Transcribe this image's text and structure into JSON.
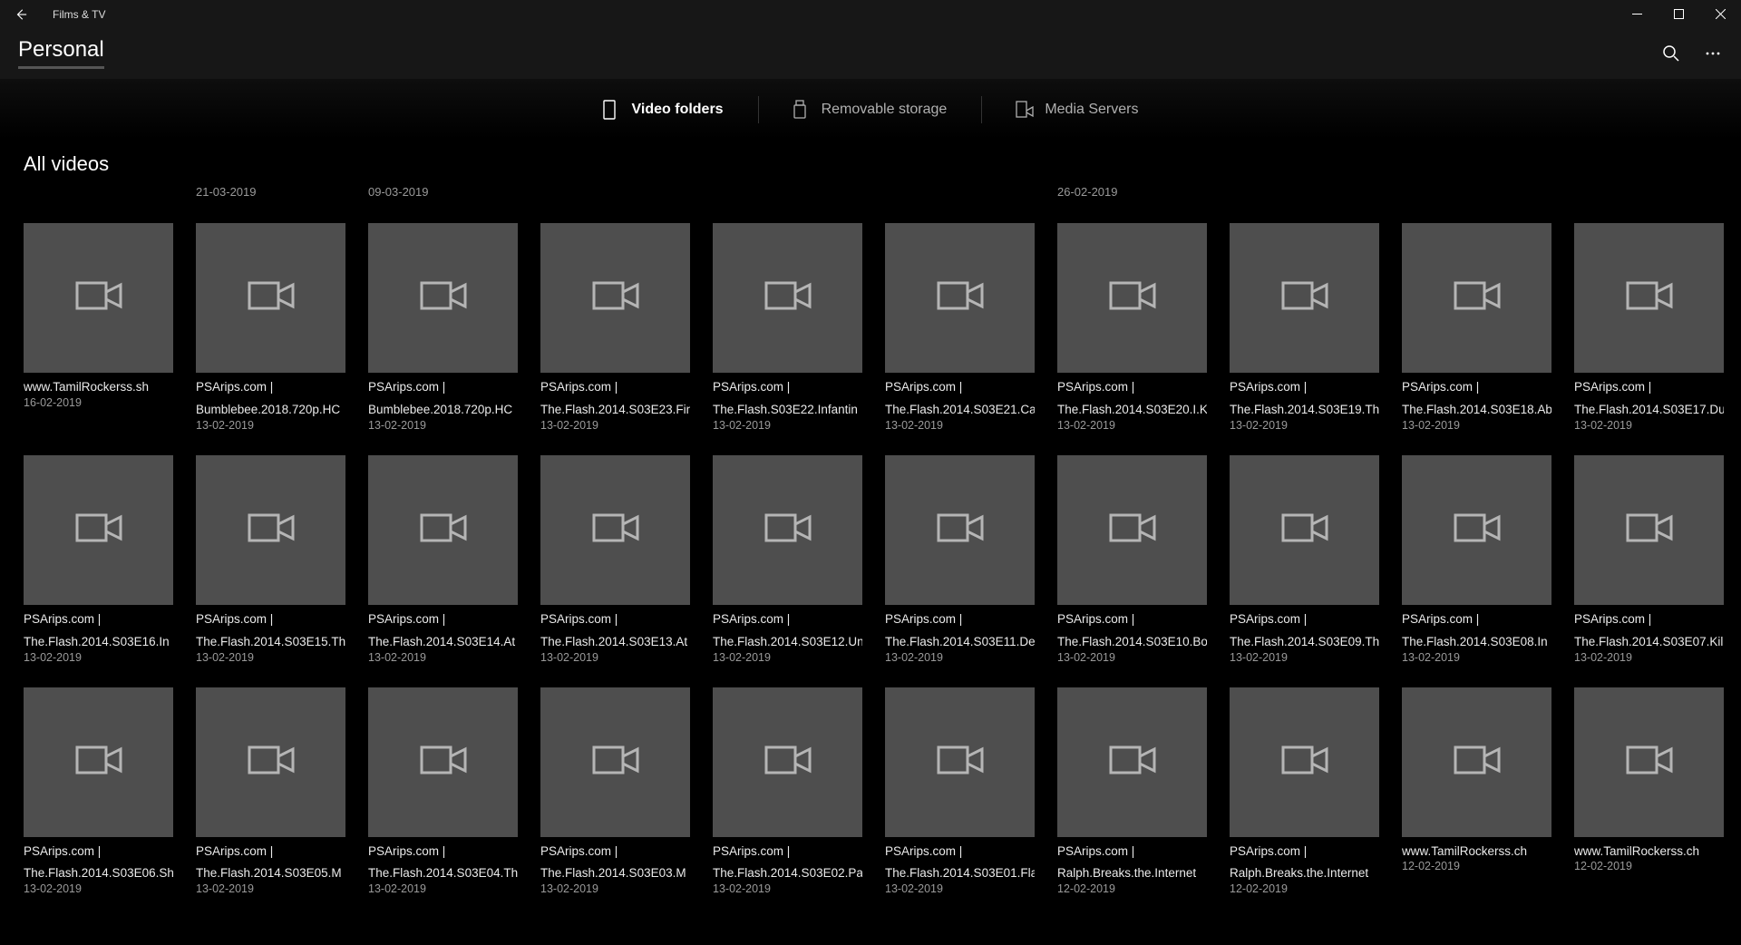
{
  "app_name": "Films & TV",
  "page_title": "Personal",
  "tabs": {
    "video_folders": "Video folders",
    "removable_storage": "Removable storage",
    "media_servers": "Media Servers"
  },
  "section_title": "All videos",
  "date_headers": [
    "",
    "21-03-2019",
    "09-03-2019",
    "",
    "",
    "",
    "26-02-2019",
    "",
    "",
    ""
  ],
  "items": [
    {
      "name": "www.TamilRockerss.sh",
      "name2": "",
      "date": "16-02-2019"
    },
    {
      "name": "PSArips.com |",
      "name2": "Bumblebee.2018.720p.HC",
      "date": "13-02-2019"
    },
    {
      "name": "PSArips.com |",
      "name2": "Bumblebee.2018.720p.HC",
      "date": "13-02-2019"
    },
    {
      "name": "PSArips.com |",
      "name2": "The.Flash.2014.S03E23.Fin",
      "date": "13-02-2019"
    },
    {
      "name": "PSArips.com |",
      "name2": "The.Flash.S03E22.Infantin",
      "date": "13-02-2019"
    },
    {
      "name": "PSArips.com |",
      "name2": "The.Flash.2014.S03E21.Ca",
      "date": "13-02-2019"
    },
    {
      "name": "PSArips.com |",
      "name2": "The.Flash.2014.S03E20.I.K",
      "date": "13-02-2019"
    },
    {
      "name": "PSArips.com |",
      "name2": "The.Flash.2014.S03E19.Th",
      "date": "13-02-2019"
    },
    {
      "name": "PSArips.com |",
      "name2": "The.Flash.2014.S03E18.Ab",
      "date": "13-02-2019"
    },
    {
      "name": "PSArips.com |",
      "name2": "The.Flash.2014.S03E17.Du",
      "date": "13-02-2019"
    },
    {
      "name": "PSArips.com |",
      "name2": "The.Flash.2014.S03E16.In",
      "date": "13-02-2019"
    },
    {
      "name": "PSArips.com |",
      "name2": "The.Flash.2014.S03E15.Th",
      "date": "13-02-2019"
    },
    {
      "name": "PSArips.com |",
      "name2": "The.Flash.2014.S03E14.At",
      "date": "13-02-2019"
    },
    {
      "name": "PSArips.com |",
      "name2": "The.Flash.2014.S03E13.At",
      "date": "13-02-2019"
    },
    {
      "name": "PSArips.com |",
      "name2": "The.Flash.2014.S03E12.Un",
      "date": "13-02-2019"
    },
    {
      "name": "PSArips.com |",
      "name2": "The.Flash.2014.S03E11.De",
      "date": "13-02-2019"
    },
    {
      "name": "PSArips.com |",
      "name2": "The.Flash.2014.S03E10.Bo",
      "date": "13-02-2019"
    },
    {
      "name": "PSArips.com |",
      "name2": "The.Flash.2014.S03E09.Th",
      "date": "13-02-2019"
    },
    {
      "name": "PSArips.com |",
      "name2": "The.Flash.2014.S03E08.In",
      "date": "13-02-2019"
    },
    {
      "name": "PSArips.com |",
      "name2": "The.Flash.2014.S03E07.Kil",
      "date": "13-02-2019"
    },
    {
      "name": "PSArips.com |",
      "name2": "The.Flash.2014.S03E06.Sh",
      "date": "13-02-2019"
    },
    {
      "name": "PSArips.com |",
      "name2": "The.Flash.2014.S03E05.M",
      "date": "13-02-2019"
    },
    {
      "name": "PSArips.com |",
      "name2": "The.Flash.2014.S03E04.Th",
      "date": "13-02-2019"
    },
    {
      "name": "PSArips.com |",
      "name2": "The.Flash.2014.S03E03.M",
      "date": "13-02-2019"
    },
    {
      "name": "PSArips.com |",
      "name2": "The.Flash.2014.S03E02.Pa",
      "date": "13-02-2019"
    },
    {
      "name": "PSArips.com |",
      "name2": "The.Flash.2014.S03E01.Fla",
      "date": "13-02-2019"
    },
    {
      "name": "PSArips.com |",
      "name2": "Ralph.Breaks.the.Internet",
      "date": "12-02-2019"
    },
    {
      "name": "PSArips.com |",
      "name2": "Ralph.Breaks.the.Internet",
      "date": "12-02-2019"
    },
    {
      "name": "www.TamilRockerss.ch",
      "name2": "",
      "date": "12-02-2019"
    },
    {
      "name": "www.TamilRockerss.ch",
      "name2": "",
      "date": "12-02-2019"
    }
  ]
}
